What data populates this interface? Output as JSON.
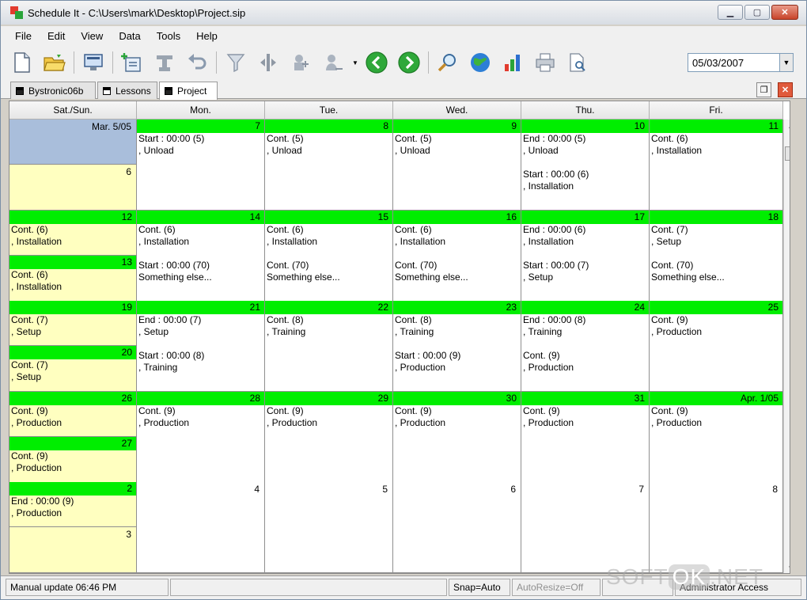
{
  "window": {
    "title": "Schedule It - C:\\Users\\mark\\Desktop\\Project.sip"
  },
  "window_controls": {
    "minimize": "▁",
    "maximize": "▢",
    "close": "✕"
  },
  "menu": [
    "File",
    "Edit",
    "View",
    "Data",
    "Tools",
    "Help"
  ],
  "toolbar": {
    "icons": [
      "new-document-icon",
      "open-folder-icon",
      "monitor-icon",
      "add-task-icon",
      "link-tool-icon",
      "undo-icon",
      "filter-icon",
      "split-icon",
      "resource-icon",
      "assign-icon",
      "back-arrow-icon",
      "forward-arrow-icon",
      "zoom-icon",
      "globe-icon",
      "bar-chart-icon",
      "print-icon",
      "print-preview-icon"
    ],
    "date": "05/03/2007",
    "dropdown_arrow": "▼"
  },
  "tabs": [
    "Bystronic06b",
    "Lessons",
    "Project"
  ],
  "tab_controls": {
    "restore": "❐",
    "close": "✕"
  },
  "calendar": {
    "headers": [
      "Sat./Sun.",
      "Mon.",
      "Tue.",
      "Wed.",
      "Thu.",
      "Fri."
    ],
    "weeks": [
      {
        "weekend": [
          {
            "date": "Mar. 5/05",
            "style": "selected",
            "entries": []
          },
          {
            "date": "6",
            "style": "plain",
            "entries": []
          }
        ],
        "days": [
          {
            "date": "7",
            "entries": [
              {
                "t": "Start : 00:00 (5)",
                "r": 0
              },
              {
                "t": ", Unload",
                "r": 1
              }
            ]
          },
          {
            "date": "8",
            "entries": [
              {
                "t": "Cont. (5)",
                "r": 0
              },
              {
                "t": ", Unload",
                "r": 1
              }
            ]
          },
          {
            "date": "9",
            "entries": [
              {
                "t": "Cont. (5)",
                "r": 0
              },
              {
                "t": ", Unload",
                "r": 1
              }
            ]
          },
          {
            "date": "10",
            "entries": [
              {
                "t": "End : 00:00 (5)",
                "r": 0
              },
              {
                "t": ", Unload",
                "r": 1
              },
              {
                "t": "Start : 00:00 (6)",
                "r": 3
              },
              {
                "t": ", Installation",
                "r": 4
              }
            ]
          },
          {
            "date": "11",
            "entries": [
              {
                "t": "Cont. (6)",
                "r": 0
              },
              {
                "t": ", Installation",
                "r": 1
              }
            ]
          }
        ]
      },
      {
        "weekend": [
          {
            "date": "12",
            "style": "green",
            "entries": [
              {
                "t": "Cont. (6)",
                "r": 0
              },
              {
                "t": ", Installation",
                "r": 1
              }
            ]
          },
          {
            "date": "13",
            "style": "green",
            "entries": [
              {
                "t": "Cont. (6)",
                "r": 0
              },
              {
                "t": ", Installation",
                "r": 1
              }
            ]
          }
        ],
        "days": [
          {
            "date": "14",
            "entries": [
              {
                "t": "Cont. (6)",
                "r": 0
              },
              {
                "t": ", Installation",
                "r": 1
              },
              {
                "t": "Start : 00:00 (70)",
                "r": 3
              },
              {
                "t": "Something else...",
                "r": 4
              }
            ]
          },
          {
            "date": "15",
            "entries": [
              {
                "t": "Cont. (6)",
                "r": 0
              },
              {
                "t": ", Installation",
                "r": 1
              },
              {
                "t": "Cont. (70)",
                "r": 3
              },
              {
                "t": "Something else...",
                "r": 4
              }
            ]
          },
          {
            "date": "16",
            "entries": [
              {
                "t": "Cont. (6)",
                "r": 0
              },
              {
                "t": ", Installation",
                "r": 1
              },
              {
                "t": "Cont. (70)",
                "r": 3
              },
              {
                "t": "Something else...",
                "r": 4
              }
            ]
          },
          {
            "date": "17",
            "entries": [
              {
                "t": "End : 00:00 (6)",
                "r": 0
              },
              {
                "t": ", Installation",
                "r": 1
              },
              {
                "t": "Start : 00:00 (7)",
                "r": 3
              },
              {
                "t": ", Setup",
                "r": 4
              }
            ]
          },
          {
            "date": "18",
            "entries": [
              {
                "t": "Cont. (7)",
                "r": 0
              },
              {
                "t": ", Setup",
                "r": 1
              },
              {
                "t": "Cont. (70)",
                "r": 3
              },
              {
                "t": "Something else...",
                "r": 4
              }
            ]
          }
        ]
      },
      {
        "weekend": [
          {
            "date": "19",
            "style": "green",
            "entries": [
              {
                "t": "Cont. (7)",
                "r": 0
              },
              {
                "t": ", Setup",
                "r": 1
              }
            ]
          },
          {
            "date": "20",
            "style": "green",
            "entries": [
              {
                "t": "Cont. (7)",
                "r": 0
              },
              {
                "t": ", Setup",
                "r": 1
              }
            ]
          }
        ],
        "days": [
          {
            "date": "21",
            "entries": [
              {
                "t": "End : 00:00 (7)",
                "r": 0
              },
              {
                "t": ", Setup",
                "r": 1
              },
              {
                "t": "Start : 00:00 (8)",
                "r": 3
              },
              {
                "t": ", Training",
                "r": 4
              }
            ]
          },
          {
            "date": "22",
            "entries": [
              {
                "t": "Cont. (8)",
                "r": 0
              },
              {
                "t": ", Training",
                "r": 1
              }
            ]
          },
          {
            "date": "23",
            "entries": [
              {
                "t": "Cont. (8)",
                "r": 0
              },
              {
                "t": ", Training",
                "r": 1
              },
              {
                "t": "Start : 00:00 (9)",
                "r": 3
              },
              {
                "t": ", Production",
                "r": 4
              }
            ]
          },
          {
            "date": "24",
            "entries": [
              {
                "t": "End : 00:00 (8)",
                "r": 0
              },
              {
                "t": ", Training",
                "r": 1
              },
              {
                "t": "Cont. (9)",
                "r": 3
              },
              {
                "t": ", Production",
                "r": 4
              }
            ]
          },
          {
            "date": "25",
            "entries": [
              {
                "t": "Cont. (9)",
                "r": 0
              },
              {
                "t": ", Production",
                "r": 1
              }
            ]
          }
        ]
      },
      {
        "weekend": [
          {
            "date": "26",
            "style": "green",
            "entries": [
              {
                "t": "Cont. (9)",
                "r": 0
              },
              {
                "t": ", Production",
                "r": 1
              }
            ]
          },
          {
            "date": "27",
            "style": "green",
            "entries": [
              {
                "t": "Cont. (9)",
                "r": 0
              },
              {
                "t": ", Production",
                "r": 1
              }
            ]
          }
        ],
        "days": [
          {
            "date": "28",
            "entries": [
              {
                "t": "Cont. (9)",
                "r": 0
              },
              {
                "t": ", Production",
                "r": 1
              }
            ]
          },
          {
            "date": "29",
            "entries": [
              {
                "t": "Cont. (9)",
                "r": 0
              },
              {
                "t": ", Production",
                "r": 1
              }
            ]
          },
          {
            "date": "30",
            "entries": [
              {
                "t": "Cont. (9)",
                "r": 0
              },
              {
                "t": ", Production",
                "r": 1
              }
            ]
          },
          {
            "date": "31",
            "entries": [
              {
                "t": "Cont. (9)",
                "r": 0
              },
              {
                "t": ", Production",
                "r": 1
              }
            ]
          },
          {
            "date": "Apr. 1/05",
            "entries": [
              {
                "t": "Cont. (9)",
                "r": 0
              },
              {
                "t": ", Production",
                "r": 1
              }
            ]
          }
        ]
      },
      {
        "weekend": [
          {
            "date": "2",
            "style": "green",
            "entries": [
              {
                "t": "End : 00:00 (9)",
                "r": 0
              },
              {
                "t": ", Production",
                "r": 1
              }
            ]
          },
          {
            "date": "3",
            "style": "plain",
            "entries": []
          }
        ],
        "days": [
          {
            "date": "4",
            "plain": true,
            "entries": []
          },
          {
            "date": "5",
            "plain": true,
            "entries": []
          },
          {
            "date": "6",
            "plain": true,
            "entries": []
          },
          {
            "date": "7",
            "plain": true,
            "entries": []
          },
          {
            "date": "8",
            "plain": true,
            "entries": []
          }
        ]
      }
    ]
  },
  "scrollbar": {
    "up": "▲",
    "down": "▼"
  },
  "status": {
    "message": "Manual update 06:46 PM",
    "snap": "Snap=Auto",
    "autoresize": "AutoResize=Off",
    "user": "Administrator Access"
  },
  "watermark": {
    "pre": "SOFT",
    "ok": "OK",
    "post": ".NET"
  },
  "colors": {
    "date_bar": "#00ee00",
    "weekend": "#ffffc0",
    "selected": "#a9bedb"
  }
}
